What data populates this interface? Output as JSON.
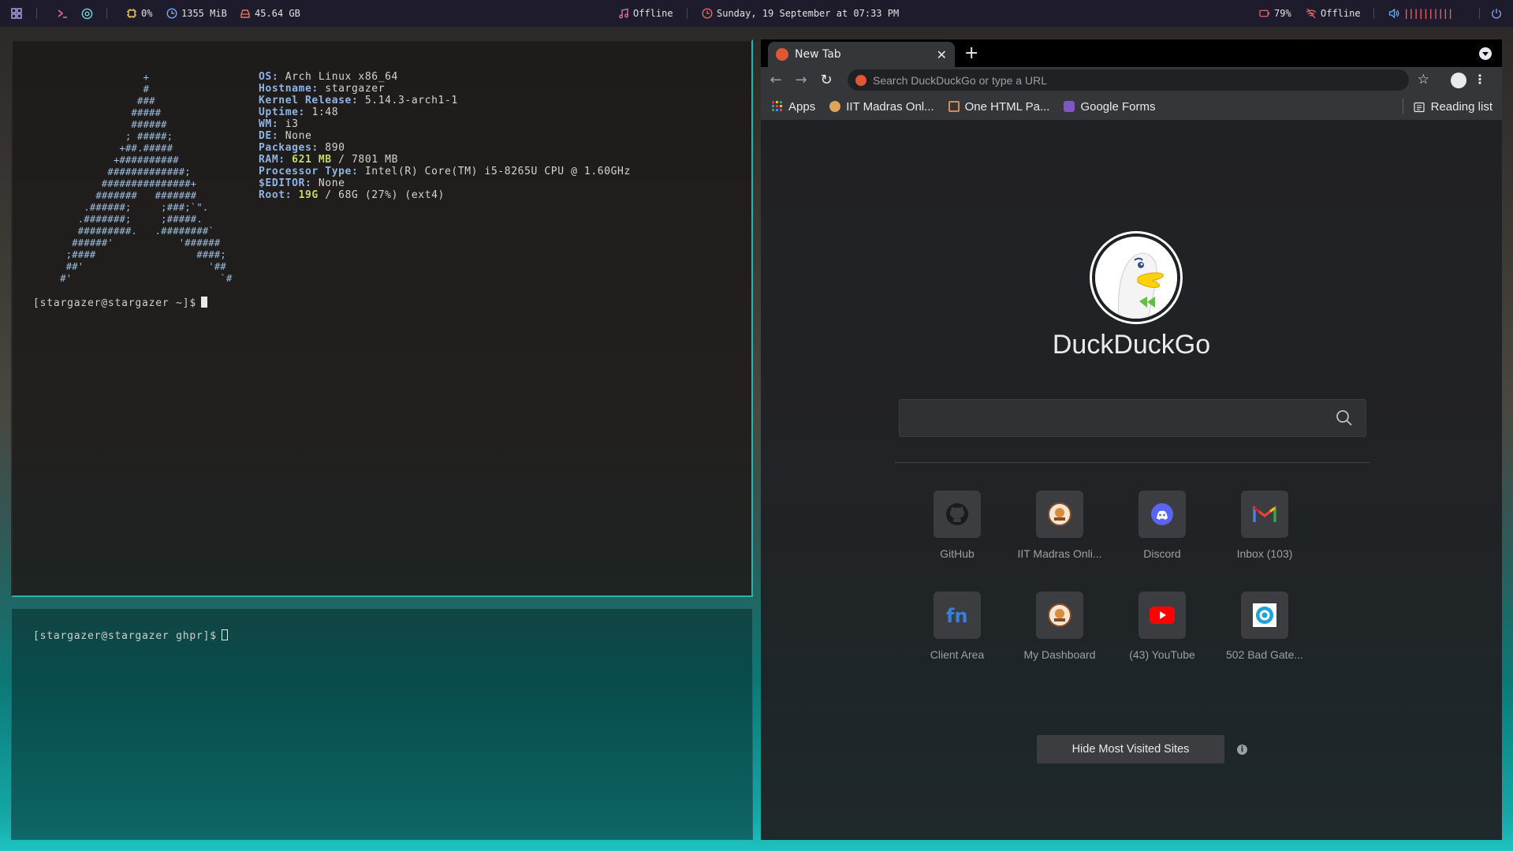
{
  "topbar": {
    "cpu": "0%",
    "memory": "1355 MiB",
    "disk": "45.64 GB",
    "music": "Offline",
    "datetime": "Sunday, 19 September at 07:33 PM",
    "battery": "79%",
    "network": "Offline",
    "volume_bars": "||||||||||"
  },
  "terminal_top": {
    "ascii_art": "                  +\n                  #\n                 ###\n                #####\n                ######\n               ; #####;\n              +##.#####\n             +##########\n            #############;\n           ###############+\n          #######   #######\n        .######;     ;###;`\".\n       .#######;     ;#####.\n       #########.   .########`\n      ######'           '######\n     ;####                 ####;\n     ##'                     '##\n    #'                         `#",
    "info": [
      {
        "key": "OS:",
        "value": "Arch Linux x86_64"
      },
      {
        "key": "Hostname:",
        "value": "stargazer"
      },
      {
        "key": "Kernel Release:",
        "value": "5.14.3-arch1-1"
      },
      {
        "key": "Uptime:",
        "value": "1:48"
      },
      {
        "key": "WM:",
        "value": "i3"
      },
      {
        "key": "DE:",
        "value": "None"
      },
      {
        "key": "Packages:",
        "value": "890"
      },
      {
        "key": "Processor Type:",
        "value": "Intel(R) Core(TM) i5-8265U CPU @ 1.60GHz"
      },
      {
        "key": "$EDITOR:",
        "value": "None"
      }
    ],
    "ram_label": "RAM:",
    "ram_used": "621 MB",
    "ram_total": "/ 7801 MB",
    "root_label": "Root:",
    "root_used": "19G",
    "root_rest": "/ 68G (27%) (ext4)",
    "prompt": "[stargazer@stargazer ~]$"
  },
  "terminal_bottom": {
    "prompt": "[stargazer@stargazer ghpr]$"
  },
  "browser": {
    "tab_title": "New Tab",
    "omnibox_placeholder": "Search DuckDuckGo or type a URL",
    "bookmarks": [
      {
        "label": "Apps",
        "icon": "apps-grid-icon"
      },
      {
        "label": "IIT Madras Onl...",
        "icon": "iitm-logo-icon"
      },
      {
        "label": "One HTML Pa...",
        "icon": "html-page-icon"
      },
      {
        "label": "Google Forms",
        "icon": "google-forms-icon"
      }
    ],
    "reading_list": "Reading list",
    "brand": "DuckDuckGo",
    "tiles": [
      {
        "label": "GitHub",
        "icon": "github-icon"
      },
      {
        "label": "IIT Madras Onli...",
        "icon": "iitm-logo-icon"
      },
      {
        "label": "Discord",
        "icon": "discord-icon"
      },
      {
        "label": "Inbox (103)",
        "icon": "gmail-icon"
      },
      {
        "label": "Client Area",
        "icon": "fn-icon"
      },
      {
        "label": "My Dashboard",
        "icon": "iitm-logo-icon"
      },
      {
        "label": "(43) YouTube",
        "icon": "youtube-icon"
      },
      {
        "label": "502 Bad Gate...",
        "icon": "target-icon"
      }
    ],
    "hide_button": "Hide Most Visited Sites"
  }
}
